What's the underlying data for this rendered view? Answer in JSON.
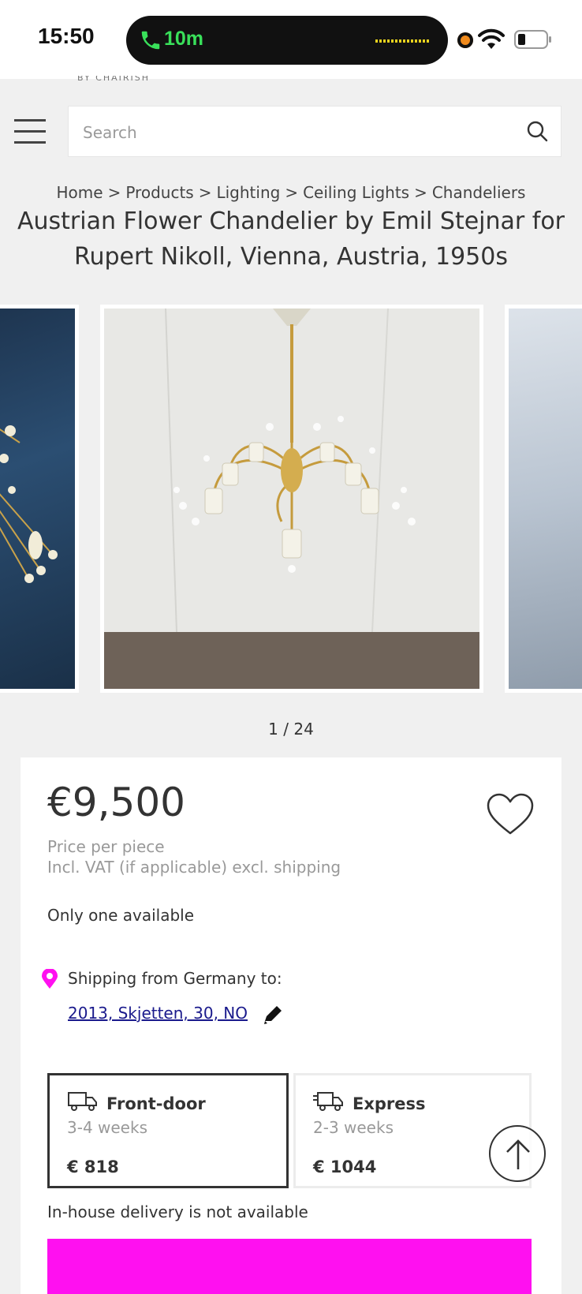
{
  "status_bar": {
    "time": "15:50",
    "call_duration": "10m"
  },
  "brand": {
    "remnant_text": "BY CHAIRISH"
  },
  "search": {
    "placeholder": "Search"
  },
  "breadcrumb": [
    "Home",
    "Products",
    "Lighting",
    "Ceiling Lights",
    "Chandeliers"
  ],
  "breadcrumb_separator": ">",
  "product": {
    "title_line1": "Austrian Flower Chandelier by Emil Stejnar for",
    "title_line2": "Rupert Nikoll, Vienna, Austria, 1950s",
    "image_counter": "1 / 24",
    "price": "€9,500",
    "price_per": "Price per piece",
    "vat_note": "Incl. VAT (if applicable) excl. shipping",
    "availability": "Only one available"
  },
  "shipping": {
    "from_label": "Shipping from Germany to:",
    "address": "2013, Skjetten, 30, NO",
    "options": [
      {
        "name": "Front-door",
        "time": "3-4 weeks",
        "price": "€ 818",
        "selected": true
      },
      {
        "name": "Express",
        "time": "2-3 weeks",
        "price": "€ 1044",
        "selected": false
      }
    ],
    "in_house_note": "In-house delivery is not available"
  },
  "colors": {
    "accent": "#ff10f0",
    "pin": "#ff10f0",
    "link": "#1a1a8c",
    "call_green": "#39e05a"
  }
}
